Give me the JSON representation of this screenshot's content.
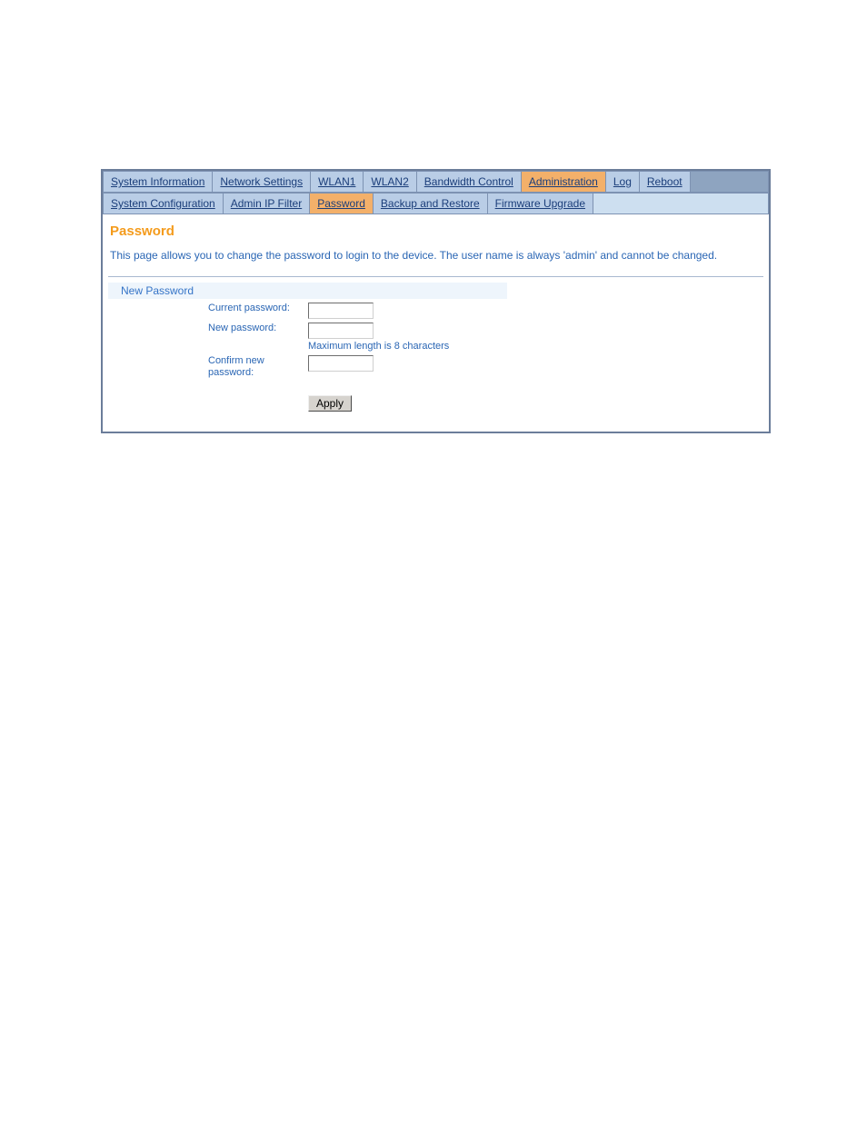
{
  "tabs": {
    "sysinfo": "System Information",
    "network": "Network Settings",
    "wlan1": "WLAN1",
    "wlan2": "WLAN2",
    "bandwidth": "Bandwidth Control",
    "admin": "Administration",
    "log": "Log",
    "reboot": "Reboot"
  },
  "subtabs": {
    "sysconfig": "System Configuration",
    "ipfilter": "Admin IP Filter",
    "password": "Password",
    "backup": "Backup and Restore",
    "firmware": "Firmware Upgrade"
  },
  "page": {
    "heading": "Password",
    "desc": "This page allows you to change the password to login to the device. The user name is always 'admin' and cannot be changed.",
    "section": "New Password"
  },
  "form": {
    "current_label": "Current password:",
    "new_label": "New password:",
    "helper": "Maximum length is 8 characters",
    "confirm_label": "Confirm new password:",
    "apply": "Apply",
    "current_value": "",
    "new_value": "",
    "confirm_value": ""
  }
}
